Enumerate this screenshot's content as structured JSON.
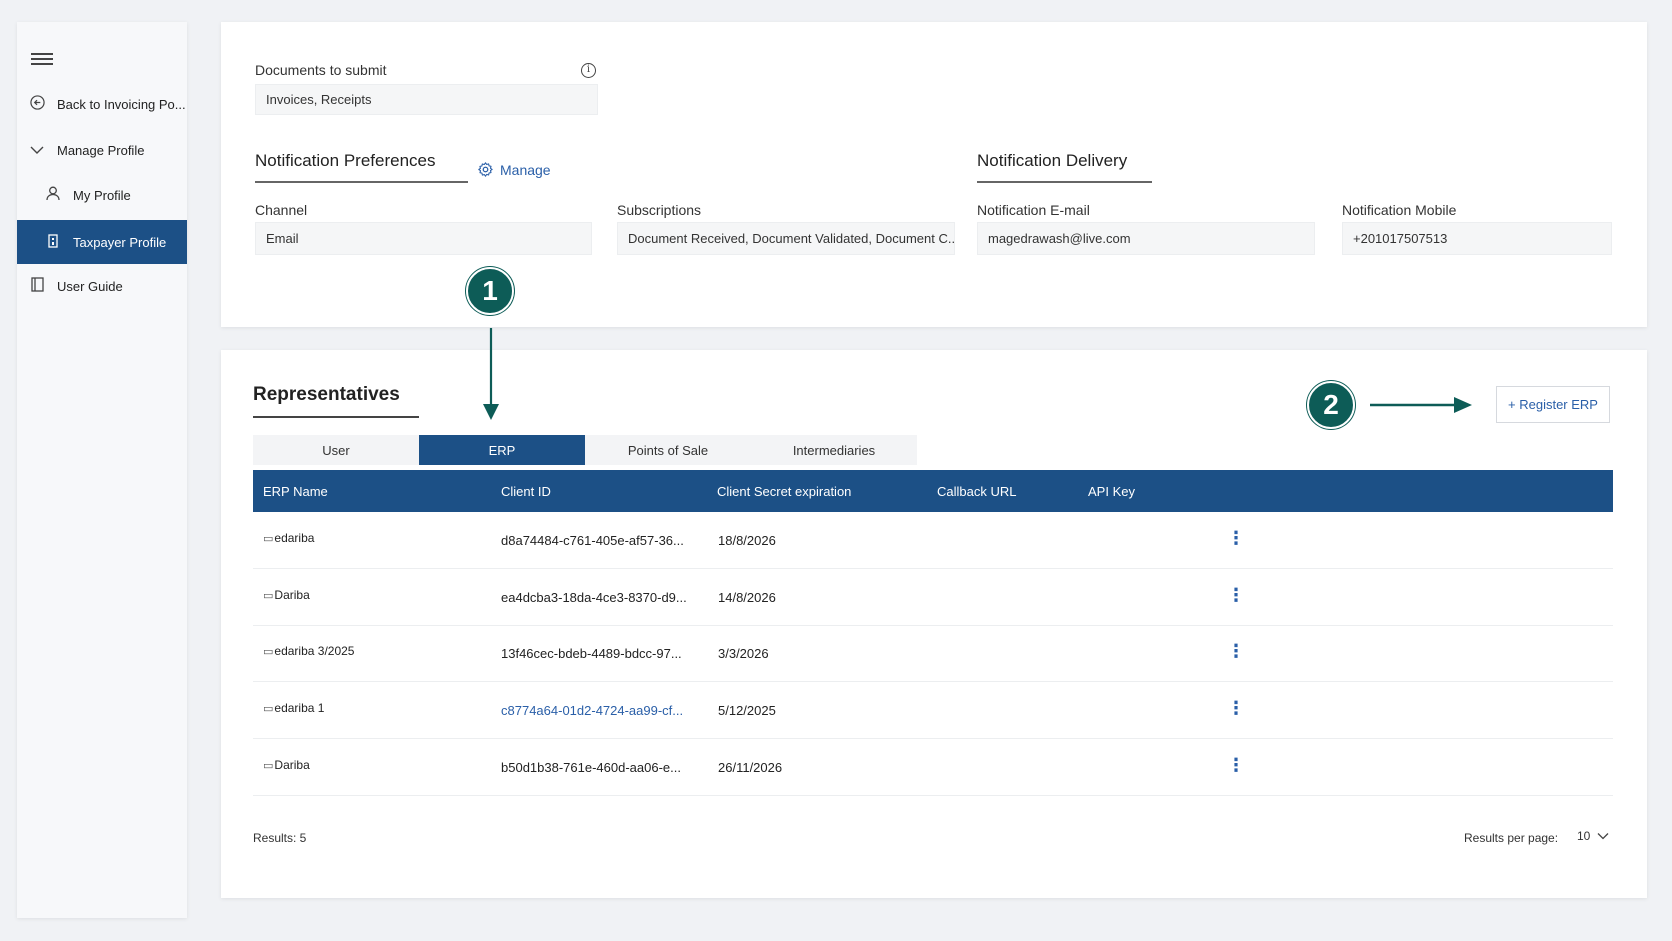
{
  "sidebar": {
    "items": [
      {
        "label": "Back to Invoicing Po..."
      },
      {
        "label": "Manage Profile"
      },
      {
        "label": "My Profile"
      },
      {
        "label": "Taxpayer Profile"
      },
      {
        "label": "User Guide"
      }
    ],
    "active_color": "#1c5086"
  },
  "documents": {
    "label": "Documents to submit",
    "value": "Invoices, Receipts"
  },
  "notification_preferences": {
    "title": "Notification Preferences",
    "manage_label": "Manage",
    "channel_label": "Channel",
    "channel_value": "Email",
    "subscriptions_label": "Subscriptions",
    "subscriptions_value": "Document Received, Document Validated, Document C..."
  },
  "notification_delivery": {
    "title": "Notification Delivery",
    "email_label": "Notification E-mail",
    "email_value": "magedrawash@live.com",
    "mobile_label": "Notification Mobile",
    "mobile_value": "+201017507513"
  },
  "annotations": {
    "badge1": "1",
    "badge2": "2",
    "color": "#0d5c57"
  },
  "representatives": {
    "title": "Representatives",
    "register_label": "+ Register ERP",
    "tabs": [
      {
        "label": "User"
      },
      {
        "label": "ERP"
      },
      {
        "label": "Points of Sale"
      },
      {
        "label": "Intermediaries"
      }
    ],
    "columns": [
      "ERP Name",
      "Client ID",
      "Client Secret expiration",
      "Callback URL",
      "API Key"
    ],
    "rows": [
      {
        "name": "edariba",
        "client_id": "d8a74484-c761-405e-af57-36...",
        "expiration": "18/8/2026"
      },
      {
        "name": "Dariba",
        "client_id": "ea4dcba3-18da-4ce3-8370-d9...",
        "expiration": "14/8/2026"
      },
      {
        "name": "edariba 3/2025",
        "client_id": "13f46cec-bdeb-4489-bdcc-97...",
        "expiration": "3/3/2026"
      },
      {
        "name": "edariba 1",
        "client_id": "c8774a64-01d2-4724-aa99-cf...",
        "expiration": "5/12/2025"
      },
      {
        "name": "Dariba",
        "client_id": "b50d1b38-761e-460d-aa06-e...",
        "expiration": "26/11/2026"
      }
    ],
    "results_label": "Results: 5",
    "per_page_label": "Results per page:",
    "per_page_value": "10"
  }
}
